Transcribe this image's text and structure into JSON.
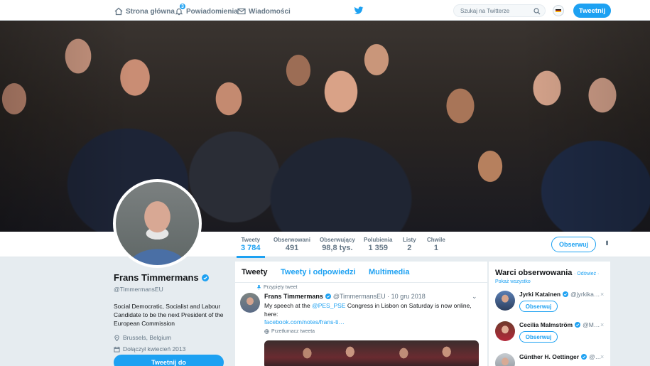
{
  "nav": {
    "home_label": "Strona główna",
    "notifications_label": "Powiadomienia",
    "notifications_count": "3",
    "messages_label": "Wiadomości",
    "search_placeholder": "Szukaj na Twitterze",
    "tweet_button": "Tweetnij"
  },
  "profile_nav": {
    "stats": [
      {
        "label": "Tweety",
        "value": "3 784"
      },
      {
        "label": "Obserwowani",
        "value": "491"
      },
      {
        "label": "Obserwujący",
        "value": "98,8 tys."
      },
      {
        "label": "Polubienia",
        "value": "1 359"
      },
      {
        "label": "Listy",
        "value": "2"
      },
      {
        "label": "Chwile",
        "value": "1"
      }
    ],
    "follow_button": "Obserwuj",
    "more_icon": "more-vertical-icon"
  },
  "profile": {
    "name": "Frans Timmermans",
    "handle": "@TimmermansEU",
    "bio": "Social Democratic, Socialist and Labour Candidate to be the next President of the European Commission",
    "location": "Brussels, Belgium",
    "joined": "Dołączył kwiecień 2013",
    "tweet_to_button": "Tweetnij do"
  },
  "timeline": {
    "tabs": [
      "Tweety",
      "Tweety i odpowiedzi",
      "Multimedia"
    ],
    "tweet": {
      "pinned_label": "Przypięty tweet",
      "author": "Frans Timmermans",
      "handle_date": "@TimmermansEU · 10 gru 2018",
      "text_before": "My speech at the ",
      "mention": "@PES_PSE",
      "text_after": " Congress in Lisbon on Saturday is now online, here:",
      "link": "facebook.com/notes/frans-ti…",
      "translate_label": "Przetłumacz tweeta"
    }
  },
  "who_to_follow": {
    "title": "Warci obserwowania",
    "refresh_link": "· Odśwież ·",
    "show_all_link": "Pokaż wszystko",
    "follow_label": "Obserwuj",
    "suggestions": [
      {
        "name": "Jyrki Katainen",
        "handle": "@jyrkika…"
      },
      {
        "name": "Cecilia Malmström",
        "handle": "@M…"
      },
      {
        "name": "Günther H. Oettinger",
        "handle": "@…"
      }
    ]
  },
  "colors": {
    "accent": "#1da1f2",
    "background": "#e6ecf0",
    "text": "#14171a",
    "muted": "#657786"
  }
}
